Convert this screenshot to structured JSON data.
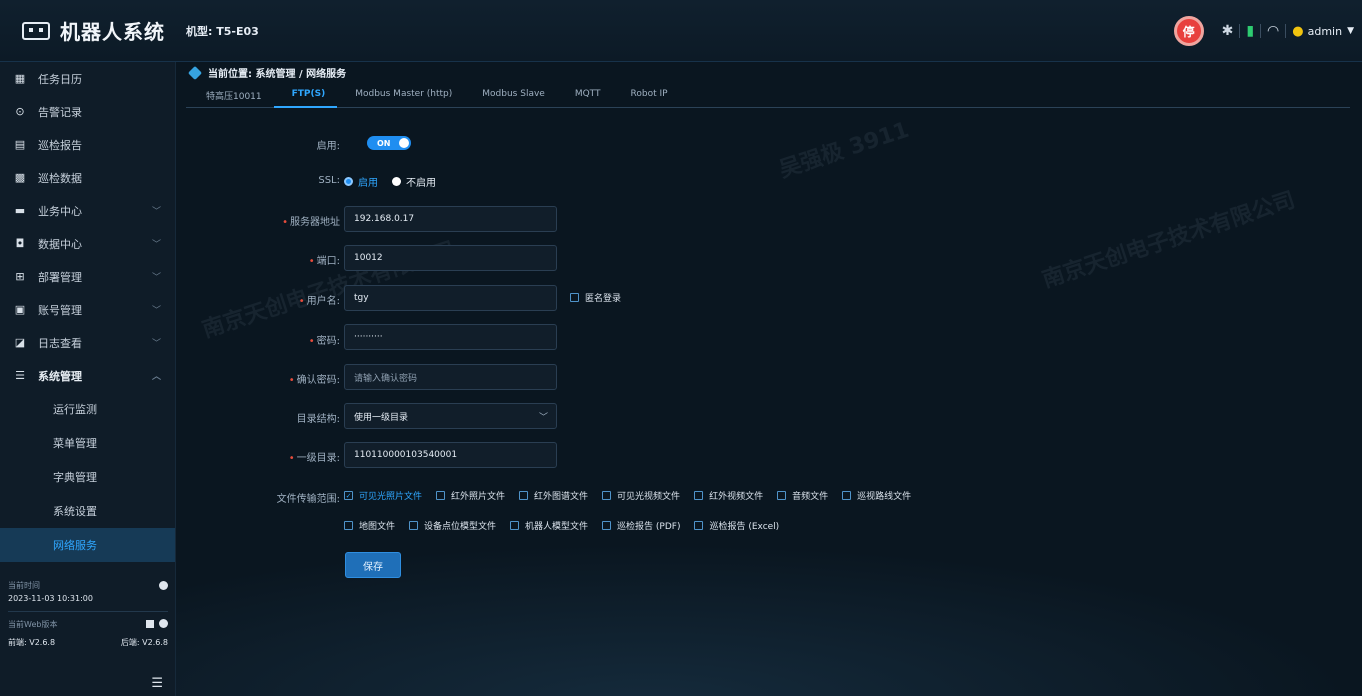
{
  "header": {
    "app_title": "机器人系统",
    "model_text": "机型: T5-E03",
    "stop_label": "停",
    "user_name": "admin"
  },
  "sidebar": {
    "items": [
      {
        "label": "任务日历",
        "icon": "calendar-icon",
        "has_children": false
      },
      {
        "label": "告警记录",
        "icon": "alarm-icon",
        "has_children": false
      },
      {
        "label": "巡检报告",
        "icon": "report-icon",
        "has_children": false
      },
      {
        "label": "巡检数据",
        "icon": "data-icon",
        "has_children": false
      },
      {
        "label": "业务中心",
        "icon": "folder-icon",
        "has_children": true
      },
      {
        "label": "数据中心",
        "icon": "database-icon",
        "has_children": true
      },
      {
        "label": "部署管理",
        "icon": "deploy-icon",
        "has_children": true
      },
      {
        "label": "账号管理",
        "icon": "account-icon",
        "has_children": true
      },
      {
        "label": "日志查看",
        "icon": "log-icon",
        "has_children": true
      },
      {
        "label": "系统管理",
        "icon": "system-icon",
        "has_children": true,
        "expanded": true
      }
    ],
    "sub_items": [
      {
        "label": "运行监测"
      },
      {
        "label": "菜单管理"
      },
      {
        "label": "字典管理"
      },
      {
        "label": "系统设置"
      },
      {
        "label": "网络服务",
        "active": true
      }
    ],
    "info": {
      "time_label": "当前时间",
      "time_value": "2023-11-03 10:31:00",
      "web_version_label": "当前Web版本",
      "front_version": "前端: V2.6.8",
      "back_version": "后端: V2.6.8"
    }
  },
  "breadcrumb": "当前位置: 系统管理 / 网络服务",
  "tabs": [
    {
      "label": "特高压10011"
    },
    {
      "label": "FTP(S)",
      "active": true
    },
    {
      "label": "Modbus Master (http)"
    },
    {
      "label": "Modbus Slave"
    },
    {
      "label": "MQTT"
    },
    {
      "label": "Robot IP"
    }
  ],
  "form": {
    "enable_label": "启用:",
    "enable_value": "ON",
    "ssl_label": "SSL:",
    "ssl_options": [
      {
        "label": "启用",
        "checked": true
      },
      {
        "label": "不启用",
        "checked": false
      }
    ],
    "server_label": "服务器地址",
    "server_value": "192.168.0.17",
    "port_label": "端口:",
    "port_value": "10012",
    "username_label": "用户名:",
    "username_value": "tgy",
    "anonymous_label": "匿名登录",
    "password_label": "密码:",
    "password_value": "··········",
    "confirm_label": "确认密码:",
    "confirm_placeholder": "请输入确认密码",
    "dir_struct_label": "目录结构:",
    "dir_struct_value": "使用一级目录",
    "first_dir_label": "一级目录:",
    "first_dir_value": "110110000103540001",
    "file_range_label": "文件传输范围:",
    "file_types_row1": [
      {
        "label": "可见光照片文件",
        "checked": true
      },
      {
        "label": "红外照片文件",
        "checked": false
      },
      {
        "label": "红外图谱文件",
        "checked": false
      },
      {
        "label": "可见光视频文件",
        "checked": false
      },
      {
        "label": "红外视频文件",
        "checked": false
      },
      {
        "label": "音频文件",
        "checked": false
      },
      {
        "label": "巡视路线文件",
        "checked": false
      }
    ],
    "file_types_row2": [
      {
        "label": "地图文件",
        "checked": false
      },
      {
        "label": "设备点位模型文件",
        "checked": false
      },
      {
        "label": "机器人模型文件",
        "checked": false
      },
      {
        "label": "巡检报告 (PDF)",
        "checked": false
      },
      {
        "label": "巡检报告 (Excel)",
        "checked": false
      }
    ],
    "save_label": "保存"
  },
  "watermarks": [
    "南京天创电子技术有限公司",
    "吴强极 3911"
  ],
  "colors": {
    "accent": "#2fa7ff",
    "stop": "#e8403d",
    "background": "#0b1520"
  }
}
